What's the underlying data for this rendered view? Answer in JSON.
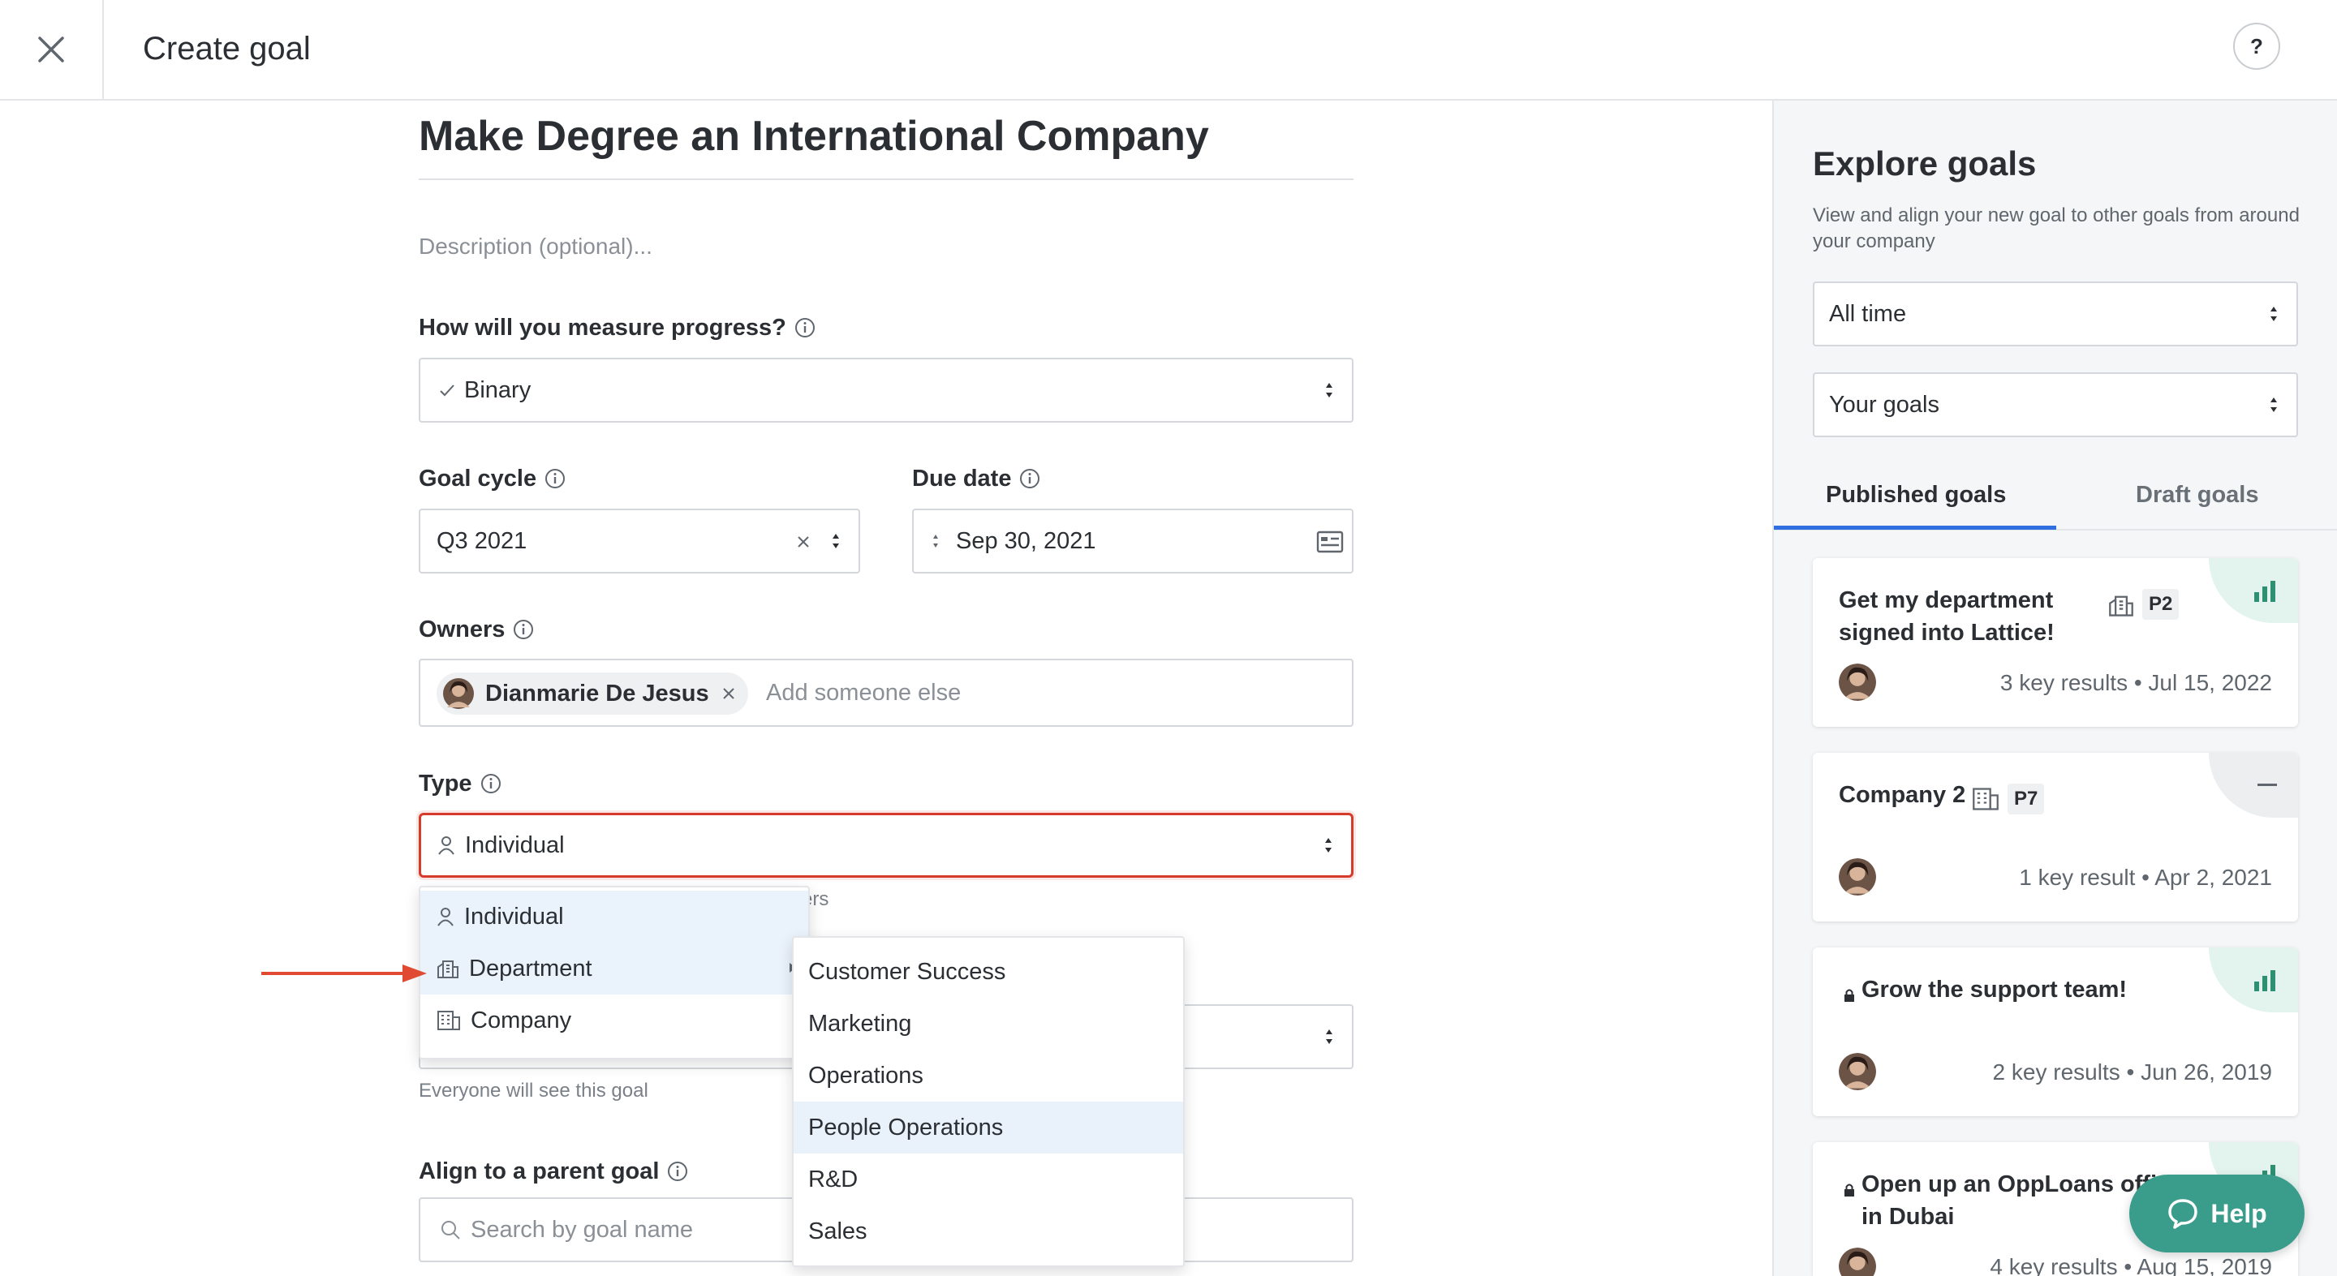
{
  "header": {
    "title": "Create goal",
    "help_label": "?"
  },
  "form": {
    "goal_title": "Make Degree an International Company",
    "description_placeholder": "Description (optional)...",
    "measure": {
      "label": "How will you measure progress?",
      "value": "Binary"
    },
    "goal_cycle": {
      "label": "Goal cycle",
      "value": "Q3 2021"
    },
    "due_date": {
      "label": "Due date",
      "value": "Sep 30, 2021"
    },
    "owners": {
      "label": "Owners",
      "chip": "Dianmarie De Jesus",
      "placeholder": "Add someone else"
    },
    "type": {
      "label": "Type",
      "value": "Individual",
      "hint_fragment": "ers"
    },
    "visibility_hint": "Everyone will see this goal",
    "parent": {
      "label": "Align to a parent goal",
      "placeholder": "Search by goal name"
    }
  },
  "type_menu": {
    "items": [
      "Individual",
      "Department",
      "Company"
    ]
  },
  "department_menu": {
    "items": [
      "Customer Success",
      "Marketing",
      "Operations",
      "People Operations",
      "R&D",
      "Sales"
    ],
    "highlighted": "People Operations"
  },
  "explore": {
    "title": "Explore goals",
    "subtitle": "View and align your new goal to other goals from around your company",
    "time_filter": "All time",
    "scope_filter": "Your goals",
    "tabs": [
      "Published goals",
      "Draft goals"
    ],
    "active_tab": "Published goals",
    "cards": [
      {
        "title": "Get my department signed into Lattice!",
        "badge": "P2",
        "meta": "3 key results • Jul 15, 2022",
        "status_icon": "bar-chart-icon"
      },
      {
        "title": "Company 2",
        "badge": "P7",
        "meta": "1 key result • Apr 2, 2021",
        "status_icon": "minus-icon"
      },
      {
        "title": "Grow the support team!",
        "meta": "2 key results • Jun 26, 2019",
        "status_icon": "bar-chart-icon"
      },
      {
        "title": "Open up an OppLoans offi",
        "title_line2": "in Dubai",
        "meta": "4 key results • Aug 15, 2019",
        "status_icon": "bar-chart-icon"
      }
    ]
  },
  "help_fab": {
    "label": "Help"
  },
  "colors": {
    "accent": "#2f6fdf",
    "error": "#d63a2a",
    "teal": "#3a9c8b",
    "highlight": "#e9f1fb"
  }
}
